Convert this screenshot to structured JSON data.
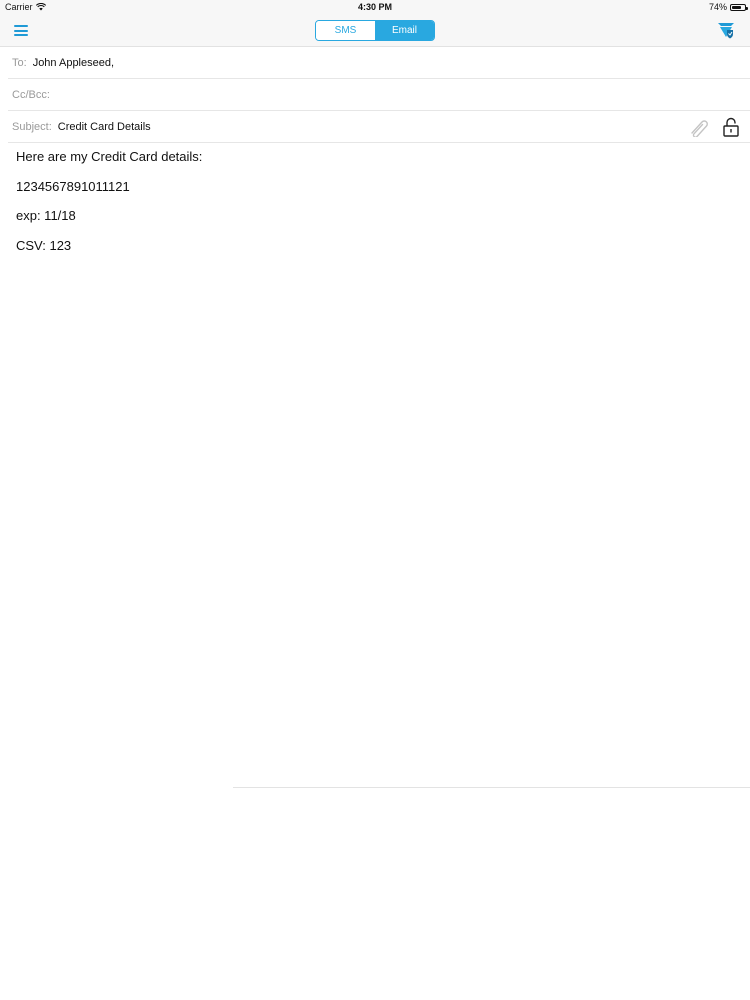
{
  "status_bar": {
    "carrier": "Carrier",
    "time": "4:30 PM",
    "battery": "74%",
    "battery_level": 0.74
  },
  "nav": {
    "menu_icon": "hamburger-menu-icon",
    "segments": [
      "SMS",
      "Email"
    ],
    "selected_segment": "Email",
    "brand_icon": "send-shield-icon",
    "accent_color": "#29a8e0"
  },
  "compose": {
    "to_label": "To:",
    "to_value": "John Appleseed,",
    "cc_label": "Cc/Bcc:",
    "cc_value": "",
    "subject_label": "Subject:",
    "subject_value": "Credit Card Details",
    "attachment_icon": "paperclip-icon",
    "lock_icon": "unlocked-padlock-icon"
  },
  "body_lines": [
    "Here are my Credit Card details:",
    "1234567891011121",
    "exp: 11/18",
    "CSV: 123"
  ]
}
